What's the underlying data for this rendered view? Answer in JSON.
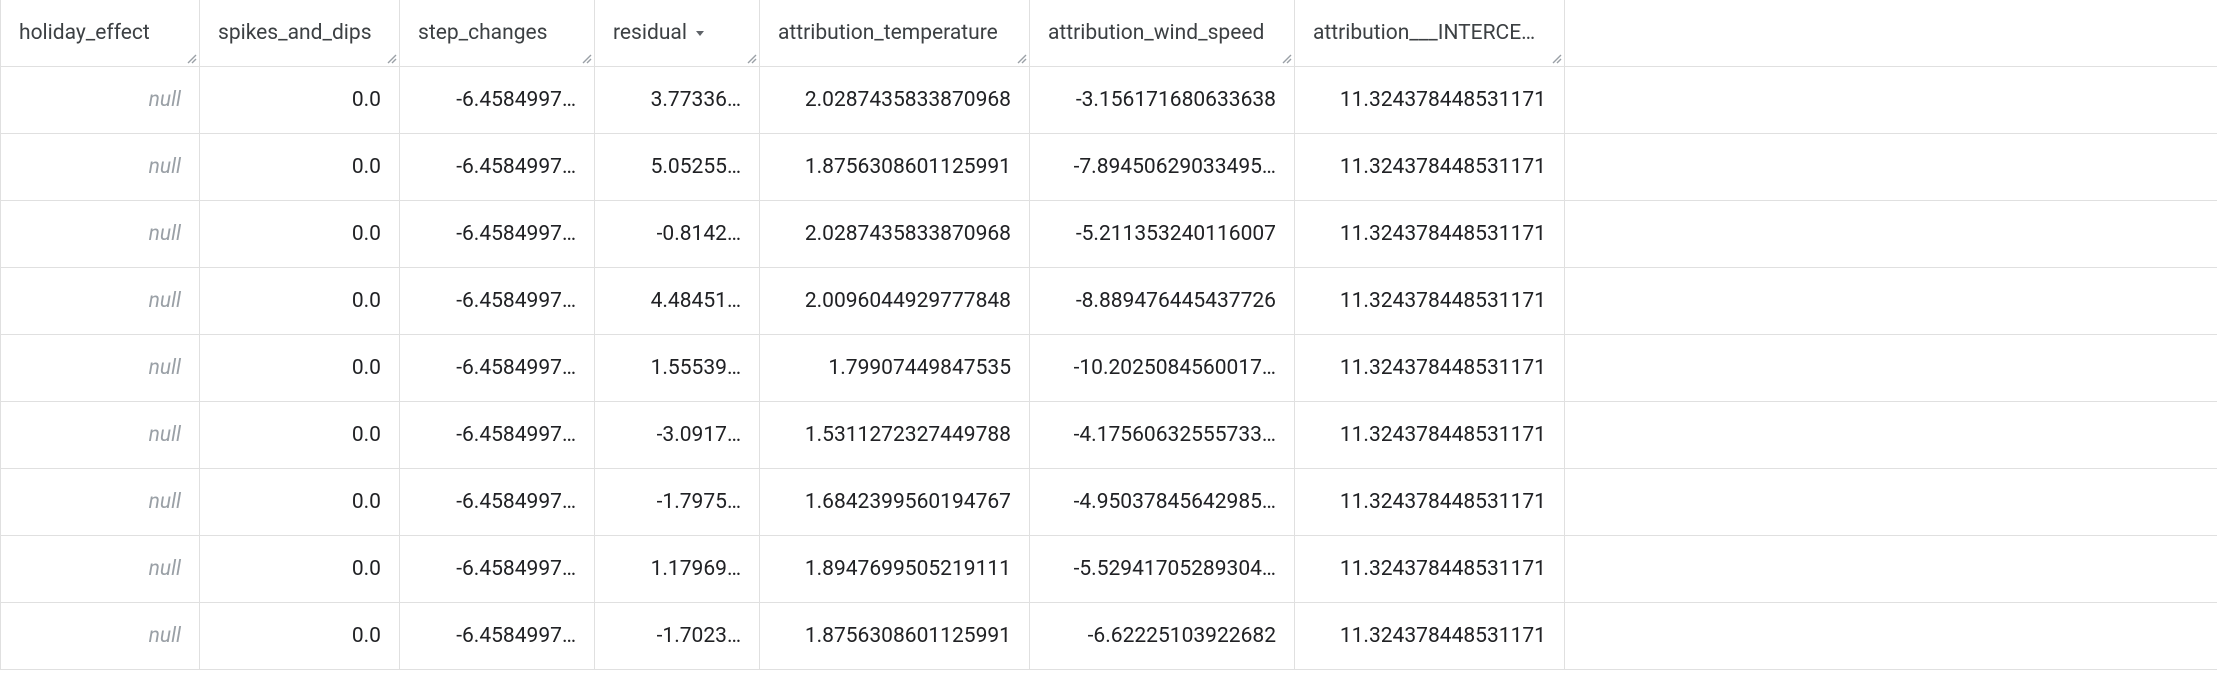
{
  "table": {
    "columns": [
      {
        "key": "holiday_effect",
        "label": "holiday_effect",
        "sorted": false
      },
      {
        "key": "spikes_and_dips",
        "label": "spikes_and_dips",
        "sorted": false
      },
      {
        "key": "step_changes",
        "label": "step_changes",
        "sorted": false
      },
      {
        "key": "residual",
        "label": "residual",
        "sorted": true
      },
      {
        "key": "attribution_temperature",
        "label": "attribution_temperature",
        "sorted": false
      },
      {
        "key": "attribution_wind_speed",
        "label": "attribution_wind_speed",
        "sorted": false
      },
      {
        "key": "attribution___INTERCEPT",
        "label": "attribution___INTERCEPT",
        "sorted": false
      }
    ],
    "rows": [
      {
        "holiday_effect": "null",
        "spikes_and_dips": "0.0",
        "step_changes": "-6.4584997…",
        "residual": "3.77336…",
        "attribution_temperature": "2.0287435833870968",
        "attribution_wind_speed": "-3.156171680633638",
        "attribution___INTERCEPT": "11.324378448531171"
      },
      {
        "holiday_effect": "null",
        "spikes_and_dips": "0.0",
        "step_changes": "-6.4584997…",
        "residual": "5.05255…",
        "attribution_temperature": "1.8756308601125991",
        "attribution_wind_speed": "-7.89450629033495…",
        "attribution___INTERCEPT": "11.324378448531171"
      },
      {
        "holiday_effect": "null",
        "spikes_and_dips": "0.0",
        "step_changes": "-6.4584997…",
        "residual": "-0.8142…",
        "attribution_temperature": "2.0287435833870968",
        "attribution_wind_speed": "-5.211353240116007",
        "attribution___INTERCEPT": "11.324378448531171"
      },
      {
        "holiday_effect": "null",
        "spikes_and_dips": "0.0",
        "step_changes": "-6.4584997…",
        "residual": "4.48451…",
        "attribution_temperature": "2.0096044929777848",
        "attribution_wind_speed": "-8.889476445437726",
        "attribution___INTERCEPT": "11.324378448531171"
      },
      {
        "holiday_effect": "null",
        "spikes_and_dips": "0.0",
        "step_changes": "-6.4584997…",
        "residual": "1.55539…",
        "attribution_temperature": "1.79907449847535",
        "attribution_wind_speed": "-10.2025084560017…",
        "attribution___INTERCEPT": "11.324378448531171"
      },
      {
        "holiday_effect": "null",
        "spikes_and_dips": "0.0",
        "step_changes": "-6.4584997…",
        "residual": "-3.0917…",
        "attribution_temperature": "1.5311272327449788",
        "attribution_wind_speed": "-4.17560632555733…",
        "attribution___INTERCEPT": "11.324378448531171"
      },
      {
        "holiday_effect": "null",
        "spikes_and_dips": "0.0",
        "step_changes": "-6.4584997…",
        "residual": "-1.7975…",
        "attribution_temperature": "1.6842399560194767",
        "attribution_wind_speed": "-4.95037845642985…",
        "attribution___INTERCEPT": "11.324378448531171"
      },
      {
        "holiday_effect": "null",
        "spikes_and_dips": "0.0",
        "step_changes": "-6.4584997…",
        "residual": "1.17969…",
        "attribution_temperature": "1.8947699505219111",
        "attribution_wind_speed": "-5.52941705289304…",
        "attribution___INTERCEPT": "11.324378448531171"
      },
      {
        "holiday_effect": "null",
        "spikes_and_dips": "0.0",
        "step_changes": "-6.4584997…",
        "residual": "-1.7023…",
        "attribution_temperature": "1.8756308601125991",
        "attribution_wind_speed": "-6.62225103922682",
        "attribution___INTERCEPT": "11.324378448531171"
      }
    ]
  },
  "icons": {
    "resize": "resize-handle-icon",
    "sort_desc": "sort-desc-icon"
  }
}
